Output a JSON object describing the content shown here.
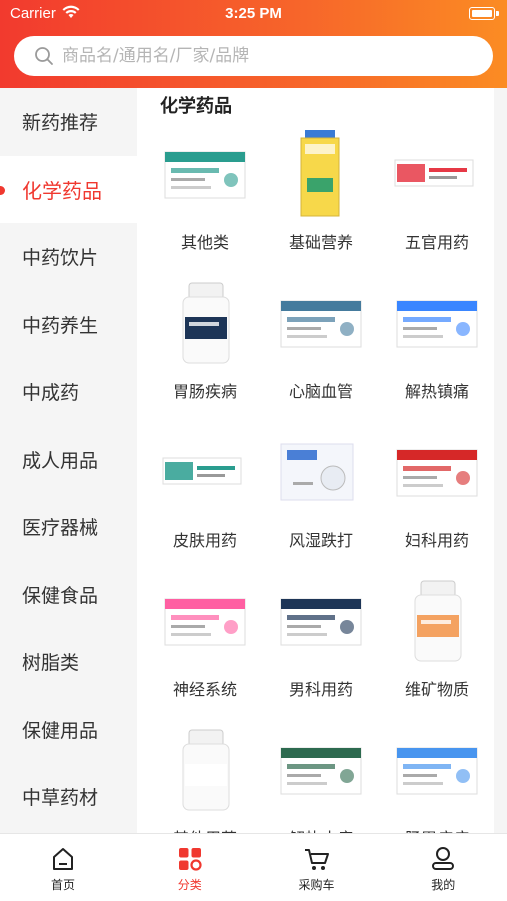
{
  "status": {
    "carrier": "Carrier",
    "time": "3:25 PM"
  },
  "search": {
    "placeholder": "商品名/通用名/厂家/品牌"
  },
  "sidebar": {
    "active_index": 1,
    "items": [
      {
        "label": "新药推荐"
      },
      {
        "label": "化学药品"
      },
      {
        "label": "中药饮片"
      },
      {
        "label": "中药养生"
      },
      {
        "label": "中成药"
      },
      {
        "label": "成人用品"
      },
      {
        "label": "医疗器械"
      },
      {
        "label": "保健食品"
      },
      {
        "label": "树脂类"
      },
      {
        "label": "保健用品"
      },
      {
        "label": "中草药材"
      }
    ]
  },
  "content": {
    "title": "化学药品",
    "categories": [
      {
        "label": "其他类",
        "icon": "medicine-box-icon"
      },
      {
        "label": "基础营养",
        "icon": "nutrition-bottle-icon"
      },
      {
        "label": "五官用药",
        "icon": "ointment-tube-icon"
      },
      {
        "label": "胃肠疾病",
        "icon": "pill-bottle-icon"
      },
      {
        "label": "心脑血管",
        "icon": "medicine-box-icon"
      },
      {
        "label": "解热镇痛",
        "icon": "medicine-box-icon"
      },
      {
        "label": "皮肤用药",
        "icon": "ointment-tube-icon"
      },
      {
        "label": "风湿跌打",
        "icon": "patch-box-icon"
      },
      {
        "label": "妇科用药",
        "icon": "medicine-box-icon"
      },
      {
        "label": "神经系统",
        "icon": "medicine-box-icon"
      },
      {
        "label": "男科用药",
        "icon": "medicine-box-icon"
      },
      {
        "label": "维矿物质",
        "icon": "pill-bottle-icon"
      },
      {
        "label": "其他用药",
        "icon": "pill-bottle-icon"
      },
      {
        "label": "解热止痛",
        "icon": "medicine-box-icon"
      },
      {
        "label": "肠胃疾病",
        "icon": "medicine-box-icon"
      }
    ]
  },
  "tabbar": {
    "active_index": 1,
    "items": [
      {
        "label": "首页",
        "icon": "home-icon"
      },
      {
        "label": "分类",
        "icon": "category-icon"
      },
      {
        "label": "采购车",
        "icon": "cart-icon"
      },
      {
        "label": "我的",
        "icon": "profile-icon"
      }
    ]
  },
  "colors": {
    "accent": "#f0382f",
    "header_start": "#f23a2e",
    "header_end": "#fb8c23"
  }
}
